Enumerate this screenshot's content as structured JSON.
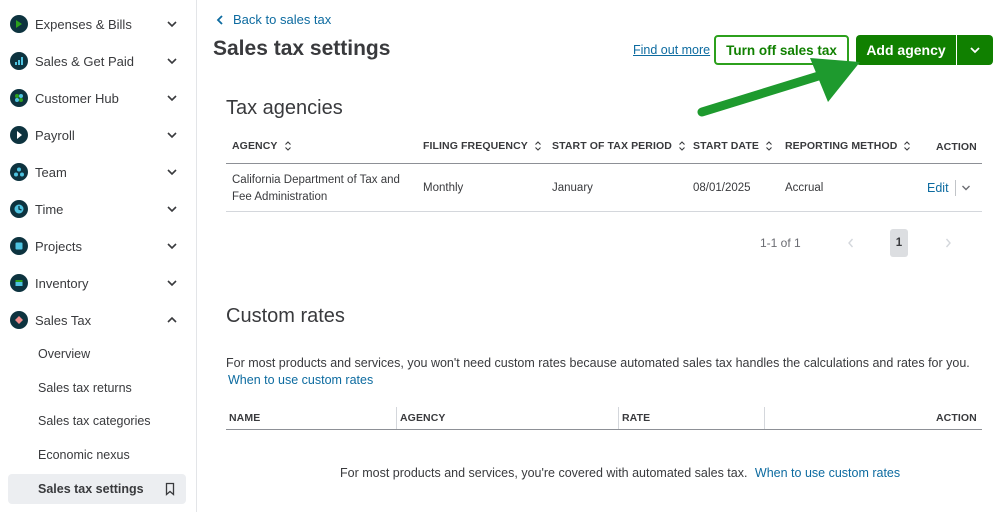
{
  "sidebar": {
    "items": [
      {
        "label": "Expenses & Bills",
        "icon": "expenses-icon",
        "color": "#0d333f"
      },
      {
        "label": "Sales & Get Paid",
        "icon": "sales-icon",
        "color": "#0d333f"
      },
      {
        "label": "Customer Hub",
        "icon": "customer-hub-icon",
        "color": "#0d333f"
      },
      {
        "label": "Payroll",
        "icon": "payroll-icon",
        "color": "#0d333f"
      },
      {
        "label": "Team",
        "icon": "team-icon",
        "color": "#0d333f"
      },
      {
        "label": "Time",
        "icon": "time-icon",
        "color": "#0d333f"
      },
      {
        "label": "Projects",
        "icon": "projects-icon",
        "color": "#0d333f"
      },
      {
        "label": "Inventory",
        "icon": "inventory-icon",
        "color": "#0d333f"
      },
      {
        "label": "Sales Tax",
        "icon": "sales-tax-icon",
        "color": "#0d333f"
      }
    ],
    "sub_items": [
      {
        "label": "Overview"
      },
      {
        "label": "Sales tax returns"
      },
      {
        "label": "Sales tax categories"
      },
      {
        "label": "Economic nexus"
      },
      {
        "label": "Sales tax settings",
        "active": true
      }
    ]
  },
  "header": {
    "back_label": "Back to sales tax",
    "title": "Sales tax settings",
    "find_out_more": "Find out more",
    "turn_off_label": "Turn off sales tax",
    "add_agency_label": "Add agency"
  },
  "agencies": {
    "title": "Tax agencies",
    "columns": [
      "AGENCY",
      "FILING FREQUENCY",
      "START OF TAX PERIOD",
      "START DATE",
      "REPORTING METHOD",
      "ACTION"
    ],
    "rows": [
      {
        "agency_line1": "California Department of Tax and",
        "agency_line2": "Fee Administration",
        "filing_frequency": "Monthly",
        "start_of_tax_period": "January",
        "start_date": "08/01/2025",
        "reporting_method": "Accrual",
        "action": "Edit"
      }
    ],
    "pagination": {
      "range": "1-1 of 1",
      "current_page": "1"
    }
  },
  "custom_rates": {
    "title": "Custom rates",
    "description": "For most products and services, you won't need custom rates because automated sales tax handles the calculations and rates for you.",
    "help_link": "When to use custom rates",
    "columns": [
      "NAME",
      "AGENCY",
      "RATE",
      "ACTION"
    ],
    "empty_message": "For most products and services, you're covered with automated sales tax.",
    "empty_link": "When to use custom rates"
  },
  "colors": {
    "brand_green": "#108000",
    "outline_green": "#2ca01c",
    "link_blue": "#0d6ba0",
    "annotation_arrow": "#1e9a2e"
  }
}
